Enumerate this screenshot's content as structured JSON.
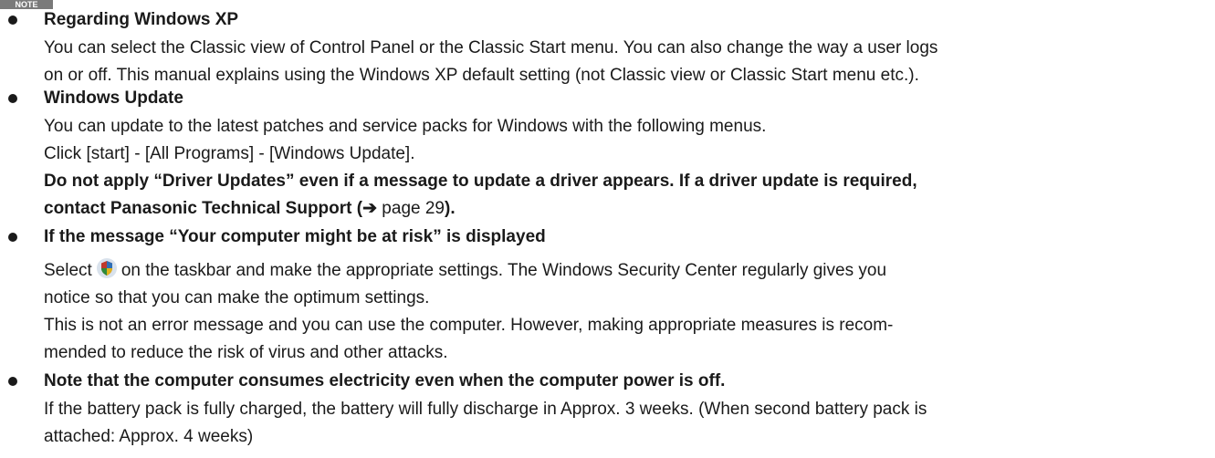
{
  "note_label": "NOTE",
  "items": [
    {
      "heading": "Regarding Windows XP",
      "lines": [
        "You can select the Classic view of Control Panel or the Classic Start menu. You can also change the way a user logs",
        "on or off. This manual explains using the Windows XP default setting (not Classic view or Classic Start menu etc.)."
      ]
    },
    {
      "heading": "Windows Update",
      "lines": [
        "You can update to the latest patches and service packs for Windows with the following menus.",
        "Click [start] - [All Programs] - [Windows Update]."
      ],
      "bold_line1": "Do not apply “Driver Updates” even if a message to update a driver appears. If a driver update is required,",
      "bold_line2_a": "contact Panasonic Technical Support (",
      "bold_line2_arrow": "➔",
      "bold_line2_ref": " page 29",
      "bold_line2_b": ")."
    },
    {
      "heading": "If the message “Your computer might be at risk” is displayed",
      "line1_a": "Select",
      "line1_icon": "security-center-shield-icon",
      "line1_b": "on the taskbar and make the appropriate settings. The Windows Security Center regularly gives you",
      "lines": [
        "notice so that you can make the optimum settings.",
        "This is not an error message and you can use the computer. However, making appropriate measures is recom-",
        "mended to reduce the risk of virus and other attacks."
      ]
    },
    {
      "heading": "Note that the computer consumes electricity even when the computer power is off.",
      "lines": [
        "If the battery pack is fully charged, the battery will fully discharge in Approx. 3 weeks. (When second battery pack is",
        "attached: Approx. 4 weeks)"
      ]
    }
  ]
}
